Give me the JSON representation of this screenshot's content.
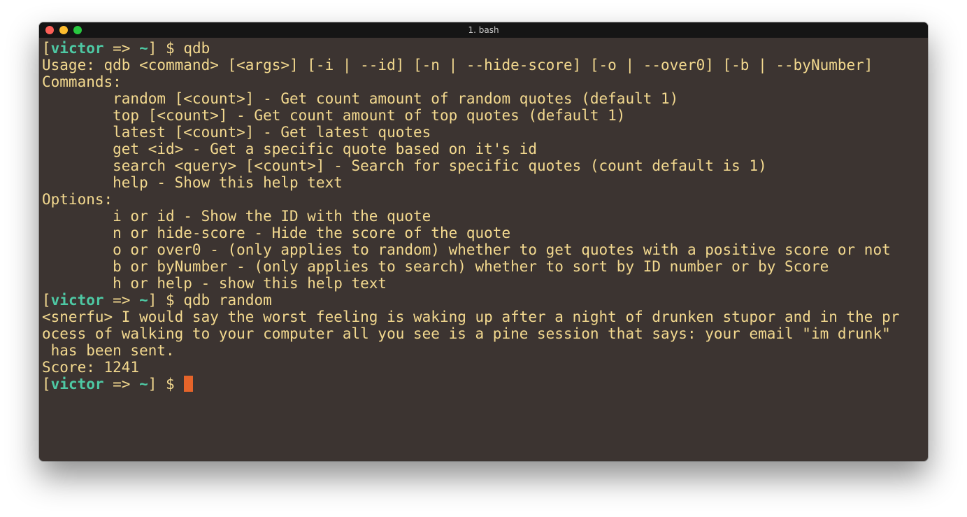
{
  "window": {
    "title": "1. bash"
  },
  "prompt": {
    "open": "[",
    "user": "victor",
    "arrow": " => ",
    "dir": "~",
    "close": "]",
    "symbol": " $ "
  },
  "commands": {
    "first": "qdb",
    "second": "qdb random",
    "third": ""
  },
  "output": {
    "usage": "Usage: qdb <command> [<args>] [-i | --id] [-n | --hide-score] [-o | --over0] [-b | --byNumber]",
    "commands_header": "Commands:",
    "commands": [
      "        random [<count>] - Get count amount of random quotes (default 1)",
      "        top [<count>] - Get count amount of top quotes (default 1)",
      "        latest [<count>] - Get latest quotes",
      "        get <id> - Get a specific quote based on it's id",
      "        search <query> [<count>] - Search for specific quotes (count default is 1)",
      "        help - Show this help text"
    ],
    "options_header": "Options:",
    "options": [
      "        i or id - Show the ID with the quote",
      "        n or hide-score - Hide the score of the quote",
      "        o or over0 - (only applies to random) whether to get quotes with a positive score or not",
      "        b or byNumber - (only applies to search) whether to sort by ID number or by Score",
      "        h or help - show this help text"
    ],
    "quote_lines": [
      "<snerfu> I would say the worst feeling is waking up after a night of drunken stupor and in the pr",
      "ocess of walking to your computer all you see is a pine session that says: your email \"im drunk\"",
      " has been sent."
    ],
    "score": "Score: 1241"
  },
  "colors": {
    "background": "#3c3431",
    "text": "#f3d98f",
    "prompt_user": "#4ec9a4",
    "cursor": "#e5642a",
    "titlebar": "#151515"
  }
}
